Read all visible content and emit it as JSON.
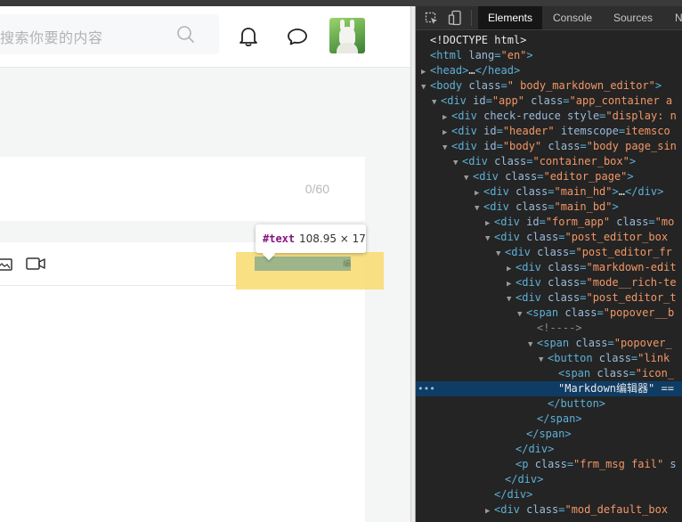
{
  "header": {
    "search_placeholder": "搜索你要的内容",
    "avatar_alt": "user avatar"
  },
  "editor": {
    "title_counter": "0/60"
  },
  "inspect_tooltip": {
    "node": "#text",
    "size": "108.95 × 17"
  },
  "devtools": {
    "tabs": [
      "Elements",
      "Console",
      "Sources",
      "N"
    ],
    "active_tab": "Elements",
    "tree": [
      {
        "indent": 1,
        "tri": "",
        "parts": [
          [
            "tx",
            "<!DOCTYPE html>"
          ]
        ]
      },
      {
        "indent": 1,
        "tri": "",
        "parts": [
          [
            "tg",
            "<html "
          ],
          [
            "an",
            "lang"
          ],
          [
            "tg",
            "="
          ],
          [
            "av",
            "\"en\""
          ],
          [
            "tg",
            ">"
          ]
        ]
      },
      {
        "indent": 1,
        "tri": "▶",
        "parts": [
          [
            "tg",
            "<head>"
          ],
          [
            "tx",
            "…"
          ],
          [
            "tg",
            "</head>"
          ]
        ]
      },
      {
        "indent": 1,
        "tri": "▼",
        "parts": [
          [
            "tg",
            "<body "
          ],
          [
            "an",
            "class"
          ],
          [
            "tg",
            "="
          ],
          [
            "av",
            "\" body_markdown_editor\""
          ],
          [
            "tg",
            ">"
          ]
        ]
      },
      {
        "indent": 2,
        "tri": "▼",
        "parts": [
          [
            "tg",
            "<div "
          ],
          [
            "an",
            "id"
          ],
          [
            "tg",
            "="
          ],
          [
            "av",
            "\"app\" "
          ],
          [
            "an",
            "class"
          ],
          [
            "tg",
            "="
          ],
          [
            "av",
            "\"app_container a"
          ]
        ]
      },
      {
        "indent": 3,
        "tri": "▶",
        "parts": [
          [
            "tg",
            "<div "
          ],
          [
            "an",
            "check-reduce style"
          ],
          [
            "tg",
            "="
          ],
          [
            "av",
            "\"display: n"
          ]
        ]
      },
      {
        "indent": 3,
        "tri": "▶",
        "parts": [
          [
            "tg",
            "<div "
          ],
          [
            "an",
            "id"
          ],
          [
            "tg",
            "="
          ],
          [
            "av",
            "\"header\" "
          ],
          [
            "an",
            "itemscope"
          ],
          [
            "tg",
            "="
          ],
          [
            "av",
            "itemsco"
          ]
        ]
      },
      {
        "indent": 3,
        "tri": "▼",
        "parts": [
          [
            "tg",
            "<div "
          ],
          [
            "an",
            "id"
          ],
          [
            "tg",
            "="
          ],
          [
            "av",
            "\"body\" "
          ],
          [
            "an",
            "class"
          ],
          [
            "tg",
            "="
          ],
          [
            "av",
            "\"body page_sin"
          ]
        ]
      },
      {
        "indent": 4,
        "tri": "▼",
        "parts": [
          [
            "tg",
            "<div "
          ],
          [
            "an",
            "class"
          ],
          [
            "tg",
            "="
          ],
          [
            "av",
            "\"container_box\""
          ],
          [
            "tg",
            ">"
          ]
        ]
      },
      {
        "indent": 5,
        "tri": "▼",
        "parts": [
          [
            "tg",
            "<div "
          ],
          [
            "an",
            "class"
          ],
          [
            "tg",
            "="
          ],
          [
            "av",
            "\"editor_page\""
          ],
          [
            "tg",
            ">"
          ]
        ]
      },
      {
        "indent": 6,
        "tri": "▶",
        "parts": [
          [
            "tg",
            "<div "
          ],
          [
            "an",
            "class"
          ],
          [
            "tg",
            "="
          ],
          [
            "av",
            "\"main_hd\""
          ],
          [
            "tg",
            ">"
          ],
          [
            "tx",
            "…"
          ],
          [
            "tg",
            "</div>"
          ]
        ]
      },
      {
        "indent": 6,
        "tri": "▼",
        "parts": [
          [
            "tg",
            "<div "
          ],
          [
            "an",
            "class"
          ],
          [
            "tg",
            "="
          ],
          [
            "av",
            "\"main_bd\""
          ],
          [
            "tg",
            ">"
          ]
        ]
      },
      {
        "indent": 7,
        "tri": "▶",
        "parts": [
          [
            "tg",
            "<div "
          ],
          [
            "an",
            "id"
          ],
          [
            "tg",
            "="
          ],
          [
            "av",
            "\"form_app\" "
          ],
          [
            "an",
            "class"
          ],
          [
            "tg",
            "="
          ],
          [
            "av",
            "\"mo"
          ]
        ]
      },
      {
        "indent": 7,
        "tri": "▼",
        "parts": [
          [
            "tg",
            "<div "
          ],
          [
            "an",
            "class"
          ],
          [
            "tg",
            "="
          ],
          [
            "av",
            "\"post_editor_box"
          ]
        ]
      },
      {
        "indent": 8,
        "tri": "▼",
        "parts": [
          [
            "tg",
            "<div "
          ],
          [
            "an",
            "class"
          ],
          [
            "tg",
            "="
          ],
          [
            "av",
            "\"post_editor_fr"
          ]
        ]
      },
      {
        "indent": 9,
        "tri": "▶",
        "parts": [
          [
            "tg",
            "<div "
          ],
          [
            "an",
            "class"
          ],
          [
            "tg",
            "="
          ],
          [
            "av",
            "\"markdown-edit"
          ]
        ]
      },
      {
        "indent": 9,
        "tri": "▶",
        "parts": [
          [
            "tg",
            "<div "
          ],
          [
            "an",
            "class"
          ],
          [
            "tg",
            "="
          ],
          [
            "av",
            "\"mode__rich-te"
          ]
        ]
      },
      {
        "indent": 9,
        "tri": "▼",
        "parts": [
          [
            "tg",
            "<div "
          ],
          [
            "an",
            "class"
          ],
          [
            "tg",
            "="
          ],
          [
            "av",
            "\"post_editor_t"
          ]
        ]
      },
      {
        "indent": 10,
        "tri": "▼",
        "parts": [
          [
            "tg",
            "<span "
          ],
          [
            "an",
            "class"
          ],
          [
            "tg",
            "="
          ],
          [
            "av",
            "\"popover__b"
          ]
        ]
      },
      {
        "indent": 11,
        "tri": "",
        "parts": [
          [
            "cm",
            "<!---->"
          ]
        ]
      },
      {
        "indent": 11,
        "tri": "▼",
        "parts": [
          [
            "tg",
            "<span "
          ],
          [
            "an",
            "class"
          ],
          [
            "tg",
            "="
          ],
          [
            "av",
            "\"popover_"
          ]
        ]
      },
      {
        "indent": 12,
        "tri": "▼",
        "parts": [
          [
            "tg",
            "<button "
          ],
          [
            "an",
            "class"
          ],
          [
            "tg",
            "="
          ],
          [
            "av",
            "\"link"
          ]
        ]
      },
      {
        "indent": 13,
        "tri": "",
        "parts": [
          [
            "tg",
            "<span "
          ],
          [
            "an",
            "class"
          ],
          [
            "tg",
            "="
          ],
          [
            "av",
            "\"icon_"
          ]
        ]
      },
      {
        "indent": 13,
        "tri": "",
        "parts": [
          [
            "tx",
            "\"Markdown编辑器\" == "
          ]
        ],
        "selected": true
      },
      {
        "indent": 12,
        "tri": "",
        "parts": [
          [
            "tg",
            "</button>"
          ]
        ]
      },
      {
        "indent": 11,
        "tri": "",
        "parts": [
          [
            "tg",
            "</span>"
          ]
        ]
      },
      {
        "indent": 10,
        "tri": "",
        "parts": [
          [
            "tg",
            "</span>"
          ]
        ]
      },
      {
        "indent": 9,
        "tri": "",
        "parts": [
          [
            "tg",
            "</div>"
          ]
        ]
      },
      {
        "indent": 9,
        "tri": "",
        "parts": [
          [
            "tg",
            "<p "
          ],
          [
            "an",
            "class"
          ],
          [
            "tg",
            "="
          ],
          [
            "av",
            "\"frm_msg fail\" "
          ],
          [
            "an",
            "s"
          ]
        ]
      },
      {
        "indent": 8,
        "tri": "",
        "parts": [
          [
            "tg",
            "</div>"
          ]
        ]
      },
      {
        "indent": 7,
        "tri": "",
        "parts": [
          [
            "tg",
            "</div>"
          ]
        ]
      },
      {
        "indent": 7,
        "tri": "▶",
        "parts": [
          [
            "tg",
            "<div "
          ],
          [
            "an",
            "class"
          ],
          [
            "tg",
            "="
          ],
          [
            "av",
            "\"mod_default_box"
          ]
        ]
      }
    ]
  }
}
